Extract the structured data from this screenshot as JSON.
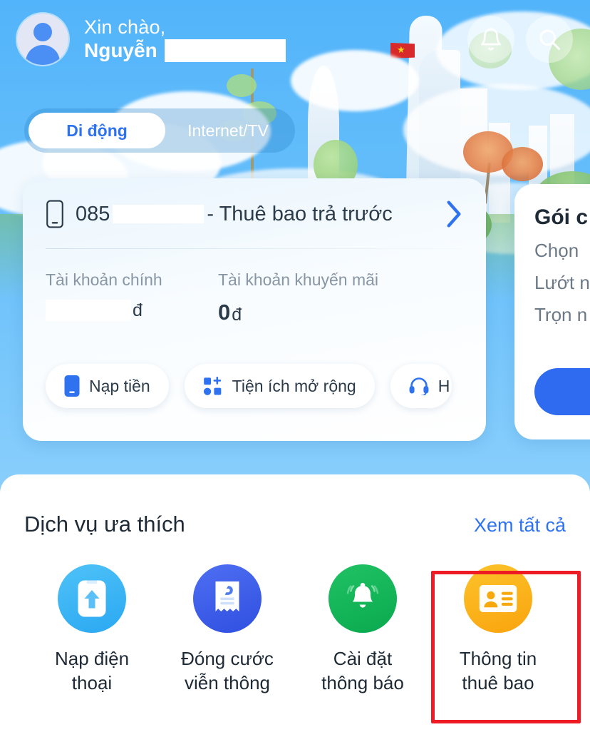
{
  "header": {
    "greeting_line1": "Xin chào,",
    "greeting_line2": "Nguyễn",
    "avatar_name": "avatar",
    "notification_icon": "bell-icon",
    "search_icon": "search-icon"
  },
  "tabs": [
    {
      "label": "Di động",
      "active": true
    },
    {
      "label": "Internet/TV",
      "active": false
    }
  ],
  "subscriber_card": {
    "msisdn_prefix": "085",
    "msisdn_suffix": "- Thuê bao trả trước",
    "chevron": "chevron-right-icon",
    "main_account_label": "Tài khoản chính",
    "main_account_unit": "đ",
    "promo_account_label": "Tài khoản khuyến mãi",
    "promo_account_value": "0",
    "promo_account_unit": "đ",
    "actions": [
      {
        "label": "Nạp tiền",
        "icon": "phone-topup-icon"
      },
      {
        "label": "Tiện ích mở rộng",
        "icon": "apps-plus-icon"
      },
      {
        "label": "H",
        "icon": "headset-icon"
      }
    ]
  },
  "right_card": {
    "title": "Gói c",
    "lines": [
      "Chọn",
      "Lướt n",
      "Trọn n"
    ],
    "cta_label": ""
  },
  "favorites": {
    "title": "Dịch vụ ưa thích",
    "see_all": "Xem tất cả",
    "items": [
      {
        "label": "Nạp điện\nthoại",
        "icon": "phone-arrow-up-icon",
        "color": "#2aa8f2",
        "highlighted": false
      },
      {
        "label": "Đóng cước\nviễn thông",
        "icon": "invoice-icon",
        "color": "#2f4fe0",
        "highlighted": false
      },
      {
        "label": "Cài đặt\nthông báo",
        "icon": "bell-ring-icon",
        "color": "#0aa94f",
        "highlighted": false
      },
      {
        "label": "Thông tin\nthuê bao",
        "icon": "id-card-icon",
        "color": "#f9a40e",
        "highlighted": true
      }
    ]
  },
  "colors": {
    "background_blue": "#6ec2fb",
    "accent_blue": "#2f72f0",
    "highlight_red": "#ef1b24"
  }
}
